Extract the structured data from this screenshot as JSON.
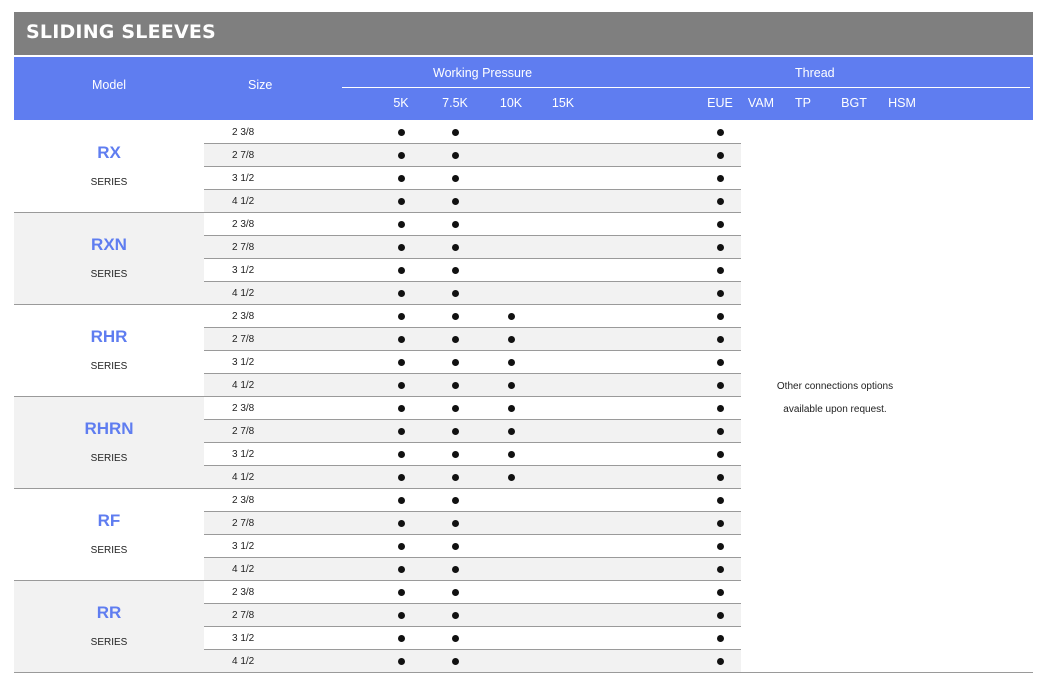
{
  "title": "SLIDING SLEEVES",
  "header": {
    "model": "Model",
    "size": "Size",
    "working_pressure": "Working Pressure",
    "thread": "Thread",
    "pressure_cols": [
      "5K",
      "7.5K",
      "10K",
      "15K"
    ],
    "thread_cols": [
      "EUE",
      "VAM",
      "TP",
      "BGT",
      "HSM"
    ]
  },
  "series_suffix": "SERIES",
  "series": [
    {
      "name": "RX",
      "sizes": [
        "2 3/8",
        "2 7/8",
        "3 1/2",
        "4 1/2"
      ],
      "pressure": [
        true,
        true,
        false,
        false
      ],
      "thread": [
        true,
        false,
        false,
        false,
        false
      ]
    },
    {
      "name": "RXN",
      "sizes": [
        "2 3/8",
        "2 7/8",
        "3 1/2",
        "4 1/2"
      ],
      "pressure": [
        true,
        true,
        false,
        false
      ],
      "thread": [
        true,
        false,
        false,
        false,
        false
      ]
    },
    {
      "name": "RHR",
      "sizes": [
        "2 3/8",
        "2 7/8",
        "3 1/2",
        "4 1/2"
      ],
      "pressure": [
        true,
        true,
        true,
        false
      ],
      "thread": [
        true,
        false,
        false,
        false,
        false
      ]
    },
    {
      "name": "RHRN",
      "sizes": [
        "2 3/8",
        "2 7/8",
        "3 1/2",
        "4 1/2"
      ],
      "pressure": [
        true,
        true,
        true,
        false
      ],
      "thread": [
        true,
        false,
        false,
        false,
        false
      ]
    },
    {
      "name": "RF",
      "sizes": [
        "2 3/8",
        "2 7/8",
        "3 1/2",
        "4 1/2"
      ],
      "pressure": [
        true,
        true,
        false,
        false
      ],
      "thread": [
        true,
        false,
        false,
        false,
        false
      ]
    },
    {
      "name": "RR",
      "sizes": [
        "2 3/8",
        "2 7/8",
        "3 1/2",
        "4 1/2"
      ],
      "pressure": [
        true,
        true,
        false,
        false
      ],
      "thread": [
        true,
        false,
        false,
        false,
        false
      ]
    }
  ],
  "note": {
    "line1": "Other connections options",
    "line2": "available upon request."
  }
}
